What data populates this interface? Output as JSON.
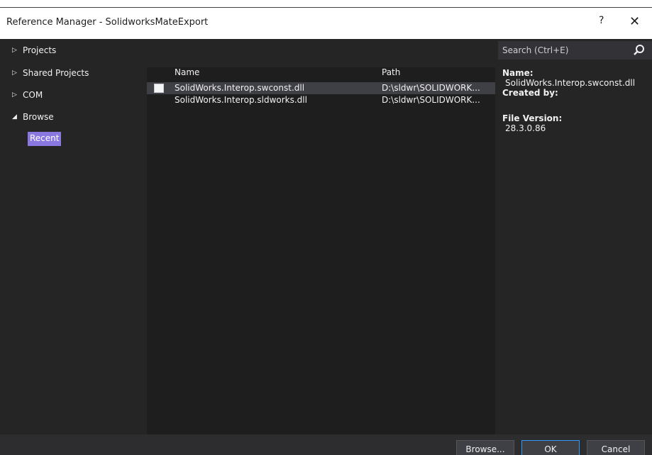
{
  "window": {
    "title": "Reference Manager - SolidworksMateExport",
    "help_glyph": "?",
    "close_glyph": "✕"
  },
  "sidebar": {
    "items": [
      {
        "arrow": "▷",
        "label": "Projects"
      },
      {
        "arrow": "▷",
        "label": "Shared Projects"
      },
      {
        "arrow": "▷",
        "label": "COM"
      },
      {
        "arrow": "◢",
        "label": "Browse"
      }
    ],
    "recent_label": "Recent"
  },
  "list": {
    "columns": {
      "name": "Name",
      "path": "Path"
    },
    "rows": [
      {
        "name": "SolidWorks.Interop.swconst.dll",
        "path": "D:\\sldwr\\SOLIDWORK...",
        "selected": true,
        "checkbox": true
      },
      {
        "name": "SolidWorks.Interop.sldworks.dll",
        "path": "D:\\sldwr\\SOLIDWORK...",
        "selected": false,
        "checkbox": false
      }
    ]
  },
  "search": {
    "placeholder": "Search (Ctrl+E)",
    "icon": "search-icon"
  },
  "details": {
    "name_label": "Name:",
    "name_value": "SolidWorks.Interop.swconst.dll",
    "created_label": "Created by:",
    "version_label": "File Version:",
    "version_value": "28.3.0.86"
  },
  "footer": {
    "browse_label": "Browse...",
    "ok_label": "OK",
    "cancel_label": "Cancel"
  },
  "colors": {
    "accent": "#8a78e0",
    "ok_border": "#3399ff",
    "background": "#252526"
  }
}
